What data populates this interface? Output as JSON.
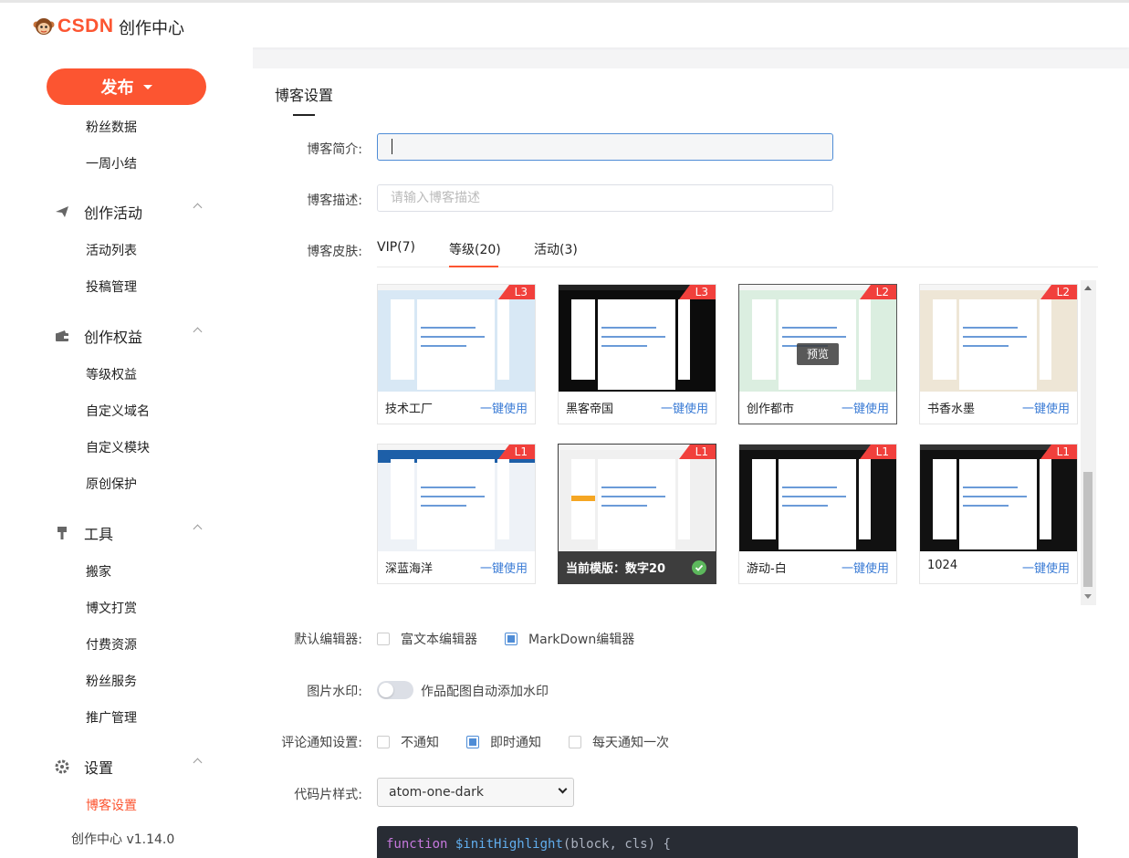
{
  "header": {
    "logo_text": "CSDN",
    "title": "创作中心"
  },
  "sidebar": {
    "publish_label": "发布",
    "items_top": [
      "粉丝数据",
      "一周小结"
    ],
    "groups": [
      {
        "label": "创作活动",
        "icon": "paper-plane-icon",
        "items": [
          "活动列表",
          "投稿管理"
        ]
      },
      {
        "label": "创作权益",
        "icon": "wallet-icon",
        "items": [
          "等级权益",
          "自定义域名",
          "自定义模块",
          "原创保护"
        ]
      },
      {
        "label": "工具",
        "icon": "brush-icon",
        "items": [
          "搬家",
          "博文打赏",
          "付费资源",
          "粉丝服务",
          "推广管理"
        ]
      },
      {
        "label": "设置",
        "icon": "gear-icon",
        "items": [
          "博客设置"
        ]
      }
    ],
    "active_item": "博客设置",
    "version": "创作中心 v1.14.0"
  },
  "main": {
    "page_title": "博客设置",
    "intro_label": "博客简介:",
    "intro_value": "",
    "desc_label": "博客描述:",
    "desc_placeholder": "请输入博客描述",
    "skin_label": "博客皮肤:",
    "skin_tabs": [
      "VIP(7)",
      "等级(20)",
      "活动(3)"
    ],
    "active_tab": "等级(20)",
    "use_label": "一键使用",
    "preview_label": "预览",
    "skins": [
      {
        "name": "技术工厂",
        "level": "L3",
        "accent": "#d8e8f5"
      },
      {
        "name": "黑客帝国",
        "level": "L3",
        "accent": "#0c0c0c"
      },
      {
        "name": "创作都市",
        "level": "L2",
        "accent": "#dbeee0"
      },
      {
        "name": "书香水墨",
        "level": "L2",
        "accent": "#eee6d6"
      },
      {
        "name": "深蓝海洋",
        "level": "L1",
        "accent": "#1d5fa8"
      },
      {
        "name": "当前模版：数字20",
        "level": "L1",
        "accent": "#f0f0f0"
      },
      {
        "name": "游动-白",
        "level": "L1",
        "accent": "#111111"
      },
      {
        "name": "1024",
        "level": "L1",
        "accent": "#111111"
      }
    ],
    "editor_label": "默认编辑器:",
    "editor_options": [
      "富文本编辑器",
      "MarkDown编辑器"
    ],
    "editor_selected": "MarkDown编辑器",
    "watermark_label": "图片水印:",
    "watermark_text": "作品配图自动添加水印",
    "watermark_on": false,
    "comment_label": "评论通知设置:",
    "comment_options": [
      "不通知",
      "即时通知",
      "每天通知一次"
    ],
    "comment_selected": "即时通知",
    "code_label": "代码片样式:",
    "code_style": "atom-one-dark",
    "code_sample": {
      "keyword": "function",
      "name": "$initHighlight",
      "rest": "(block, cls) {"
    }
  }
}
